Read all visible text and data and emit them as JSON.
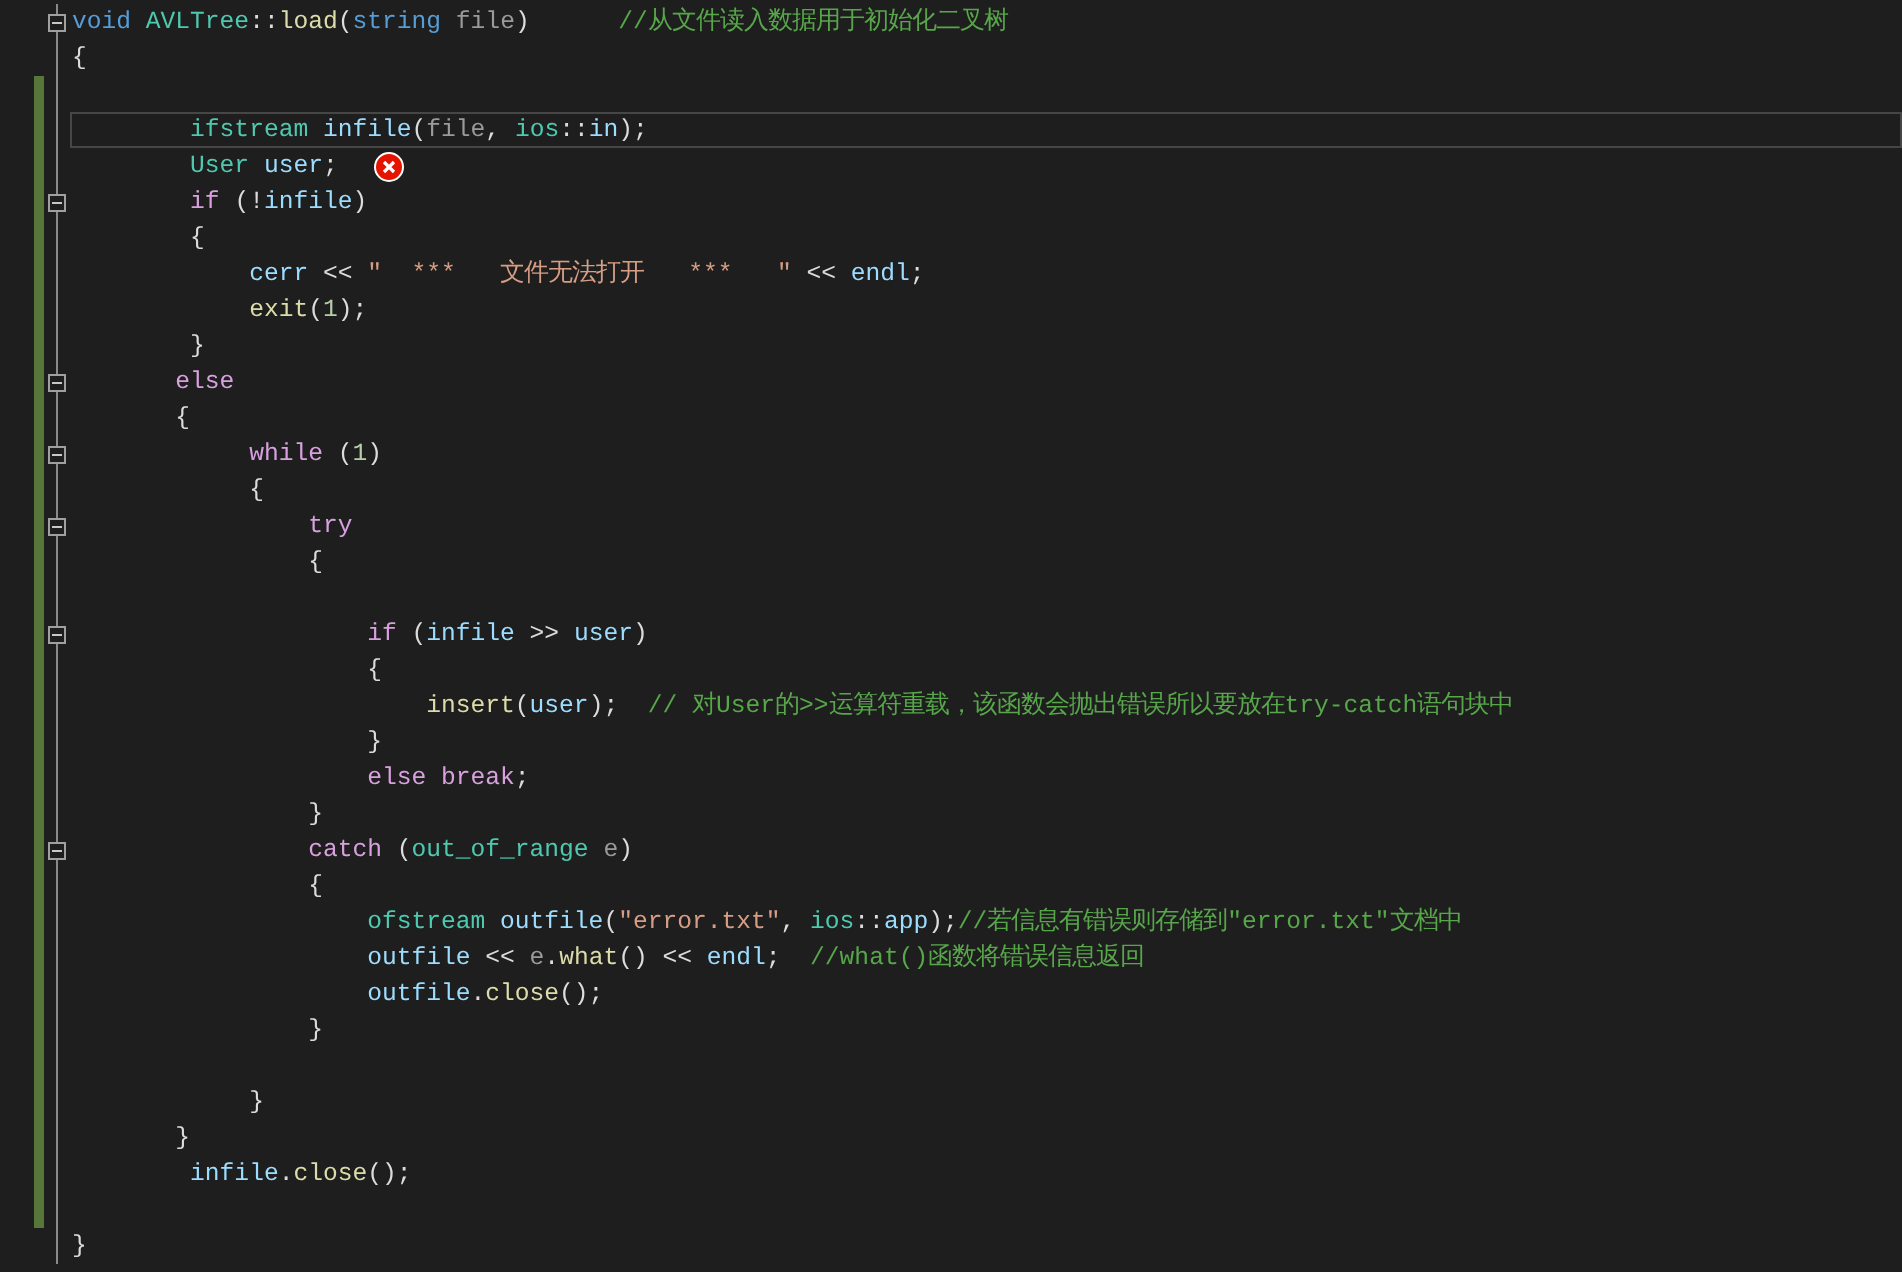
{
  "editor": {
    "lines": [
      {
        "changed": false,
        "fold": true,
        "current": false,
        "error": false,
        "tokens": [
          {
            "kind": "keyword",
            "text": "void"
          },
          {
            "kind": "type",
            "text": " AVLTree"
          },
          {
            "kind": "plain",
            "text": "::"
          },
          {
            "kind": "function",
            "text": "load"
          },
          {
            "kind": "plain",
            "text": "("
          },
          {
            "kind": "keyword",
            "text": "string"
          },
          {
            "kind": "param",
            "text": " file"
          },
          {
            "kind": "plain",
            "text": ")      "
          },
          {
            "kind": "comment",
            "text": "//从文件读入数据用于初始化二叉树"
          }
        ]
      },
      {
        "changed": false,
        "fold": false,
        "current": false,
        "error": false,
        "tokens": [
          {
            "kind": "plain",
            "text": "{"
          }
        ]
      },
      {
        "changed": true,
        "fold": false,
        "current": false,
        "error": false
      },
      {
        "changed": true,
        "fold": false,
        "current": true,
        "error": false,
        "tokens": [
          {
            "kind": "type",
            "text": "        ifstream"
          },
          {
            "kind": "variable",
            "text": " infile"
          },
          {
            "kind": "plain",
            "text": "("
          },
          {
            "kind": "param",
            "text": "file"
          },
          {
            "kind": "plain",
            "text": ", "
          },
          {
            "kind": "type",
            "text": "ios"
          },
          {
            "kind": "plain",
            "text": "::"
          },
          {
            "kind": "variable",
            "text": "in"
          },
          {
            "kind": "plain",
            "text": ");"
          }
        ]
      },
      {
        "changed": true,
        "fold": false,
        "current": false,
        "error": true,
        "tokens": [
          {
            "kind": "type",
            "text": "        User"
          },
          {
            "kind": "variable",
            "text": " user"
          },
          {
            "kind": "plain",
            "text": ";"
          }
        ]
      },
      {
        "changed": true,
        "fold": true,
        "current": false,
        "error": false,
        "tokens": [
          {
            "kind": "control",
            "text": "        if"
          },
          {
            "kind": "plain",
            "text": " (!"
          },
          {
            "kind": "variable",
            "text": "infile"
          },
          {
            "kind": "plain",
            "text": ")"
          }
        ]
      },
      {
        "changed": true,
        "fold": false,
        "current": false,
        "error": false,
        "tokens": [
          {
            "kind": "plain",
            "text": "        {"
          }
        ]
      },
      {
        "changed": true,
        "fold": false,
        "current": false,
        "error": false,
        "tokens": [
          {
            "kind": "variable",
            "text": "            cerr"
          },
          {
            "kind": "plain",
            "text": " << "
          },
          {
            "kind": "string",
            "text": "\"  ***   文件无法打开   ***   \""
          },
          {
            "kind": "plain",
            "text": " << "
          },
          {
            "kind": "variable",
            "text": "endl"
          },
          {
            "kind": "plain",
            "text": ";"
          }
        ]
      },
      {
        "changed": true,
        "fold": false,
        "current": false,
        "error": false,
        "tokens": [
          {
            "kind": "function",
            "text": "            exit"
          },
          {
            "kind": "plain",
            "text": "("
          },
          {
            "kind": "number",
            "text": "1"
          },
          {
            "kind": "plain",
            "text": ");"
          }
        ]
      },
      {
        "changed": true,
        "fold": false,
        "current": false,
        "error": false,
        "tokens": [
          {
            "kind": "plain",
            "text": "        }"
          }
        ]
      },
      {
        "changed": true,
        "fold": true,
        "current": false,
        "error": false,
        "tokens": [
          {
            "kind": "control",
            "text": "       else"
          }
        ]
      },
      {
        "changed": true,
        "fold": false,
        "current": false,
        "error": false,
        "tokens": [
          {
            "kind": "plain",
            "text": "       {"
          }
        ]
      },
      {
        "changed": true,
        "fold": true,
        "current": false,
        "error": false,
        "tokens": [
          {
            "kind": "control",
            "text": "            while"
          },
          {
            "kind": "plain",
            "text": " ("
          },
          {
            "kind": "number",
            "text": "1"
          },
          {
            "kind": "plain",
            "text": ")"
          }
        ]
      },
      {
        "changed": true,
        "fold": false,
        "current": false,
        "error": false,
        "tokens": [
          {
            "kind": "plain",
            "text": "            {"
          }
        ]
      },
      {
        "changed": true,
        "fold": true,
        "current": false,
        "error": false,
        "tokens": [
          {
            "kind": "control",
            "text": "                try"
          }
        ]
      },
      {
        "changed": true,
        "fold": false,
        "current": false,
        "error": false,
        "tokens": [
          {
            "kind": "plain",
            "text": "                {"
          }
        ]
      },
      {
        "changed": true,
        "fold": false,
        "current": false,
        "error": false
      },
      {
        "changed": true,
        "fold": true,
        "current": false,
        "error": false,
        "tokens": [
          {
            "kind": "control",
            "text": "                    if"
          },
          {
            "kind": "plain",
            "text": " ("
          },
          {
            "kind": "variable",
            "text": "infile"
          },
          {
            "kind": "plain",
            "text": " >> "
          },
          {
            "kind": "variable",
            "text": "user"
          },
          {
            "kind": "plain",
            "text": ")"
          }
        ]
      },
      {
        "changed": true,
        "fold": false,
        "current": false,
        "error": false,
        "tokens": [
          {
            "kind": "plain",
            "text": "                    {"
          }
        ]
      },
      {
        "changed": true,
        "fold": false,
        "current": false,
        "error": false,
        "tokens": [
          {
            "kind": "function",
            "text": "                        insert"
          },
          {
            "kind": "plain",
            "text": "("
          },
          {
            "kind": "variable",
            "text": "user"
          },
          {
            "kind": "plain",
            "text": ");  "
          },
          {
            "kind": "comment",
            "text": "// 对User的>>运算符重载，该函数会抛出错误所以要放在try-catch语句块中"
          }
        ]
      },
      {
        "changed": true,
        "fold": false,
        "current": false,
        "error": false,
        "tokens": [
          {
            "kind": "plain",
            "text": "                    }"
          }
        ]
      },
      {
        "changed": true,
        "fold": false,
        "current": false,
        "error": false,
        "tokens": [
          {
            "kind": "control",
            "text": "                    else"
          },
          {
            "kind": "control",
            "text": " break"
          },
          {
            "kind": "plain",
            "text": ";"
          }
        ]
      },
      {
        "changed": true,
        "fold": false,
        "current": false,
        "error": false,
        "tokens": [
          {
            "kind": "plain",
            "text": "                }"
          }
        ]
      },
      {
        "changed": true,
        "fold": true,
        "current": false,
        "error": false,
        "tokens": [
          {
            "kind": "control",
            "text": "                catch"
          },
          {
            "kind": "plain",
            "text": " ("
          },
          {
            "kind": "type",
            "text": "out_of_range"
          },
          {
            "kind": "param",
            "text": " e"
          },
          {
            "kind": "plain",
            "text": ")"
          }
        ]
      },
      {
        "changed": true,
        "fold": false,
        "current": false,
        "error": false,
        "tokens": [
          {
            "kind": "plain",
            "text": "                {"
          }
        ]
      },
      {
        "changed": true,
        "fold": false,
        "current": false,
        "error": false,
        "tokens": [
          {
            "kind": "type",
            "text": "                    ofstream"
          },
          {
            "kind": "variable",
            "text": " outfile"
          },
          {
            "kind": "plain",
            "text": "("
          },
          {
            "kind": "string",
            "text": "\"error.txt\""
          },
          {
            "kind": "plain",
            "text": ", "
          },
          {
            "kind": "type",
            "text": "ios"
          },
          {
            "kind": "plain",
            "text": "::"
          },
          {
            "kind": "variable",
            "text": "app"
          },
          {
            "kind": "plain",
            "text": ");"
          },
          {
            "kind": "comment",
            "text": "//若信息有错误则存储到\"error.txt\"文档中"
          }
        ]
      },
      {
        "changed": true,
        "fold": false,
        "current": false,
        "error": false,
        "tokens": [
          {
            "kind": "variable",
            "text": "                    outfile"
          },
          {
            "kind": "plain",
            "text": " << "
          },
          {
            "kind": "param",
            "text": "e"
          },
          {
            "kind": "plain",
            "text": "."
          },
          {
            "kind": "function",
            "text": "what"
          },
          {
            "kind": "plain",
            "text": "() << "
          },
          {
            "kind": "variable",
            "text": "endl"
          },
          {
            "kind": "plain",
            "text": ";  "
          },
          {
            "kind": "comment",
            "text": "//what()函数将错误信息返回"
          }
        ]
      },
      {
        "changed": true,
        "fold": false,
        "current": false,
        "error": false,
        "tokens": [
          {
            "kind": "variable",
            "text": "                    outfile"
          },
          {
            "kind": "plain",
            "text": "."
          },
          {
            "kind": "function",
            "text": "close"
          },
          {
            "kind": "plain",
            "text": "();"
          }
        ]
      },
      {
        "changed": true,
        "fold": false,
        "current": false,
        "error": false,
        "tokens": [
          {
            "kind": "plain",
            "text": "                }"
          }
        ]
      },
      {
        "changed": true,
        "fold": false,
        "current": false,
        "error": false
      },
      {
        "changed": true,
        "fold": false,
        "current": false,
        "error": false,
        "tokens": [
          {
            "kind": "plain",
            "text": "            }"
          }
        ]
      },
      {
        "changed": true,
        "fold": false,
        "current": false,
        "error": false,
        "tokens": [
          {
            "kind": "plain",
            "text": "       }"
          }
        ]
      },
      {
        "changed": true,
        "fold": false,
        "current": false,
        "error": false,
        "tokens": [
          {
            "kind": "variable",
            "text": "        infile"
          },
          {
            "kind": "plain",
            "text": "."
          },
          {
            "kind": "function",
            "text": "close"
          },
          {
            "kind": "plain",
            "text": "();"
          }
        ]
      },
      {
        "changed": true,
        "fold": false,
        "current": false,
        "error": false
      },
      {
        "changed": false,
        "fold": false,
        "current": false,
        "error": false,
        "tokens": [
          {
            "kind": "plain",
            "text": "}"
          }
        ]
      }
    ]
  }
}
